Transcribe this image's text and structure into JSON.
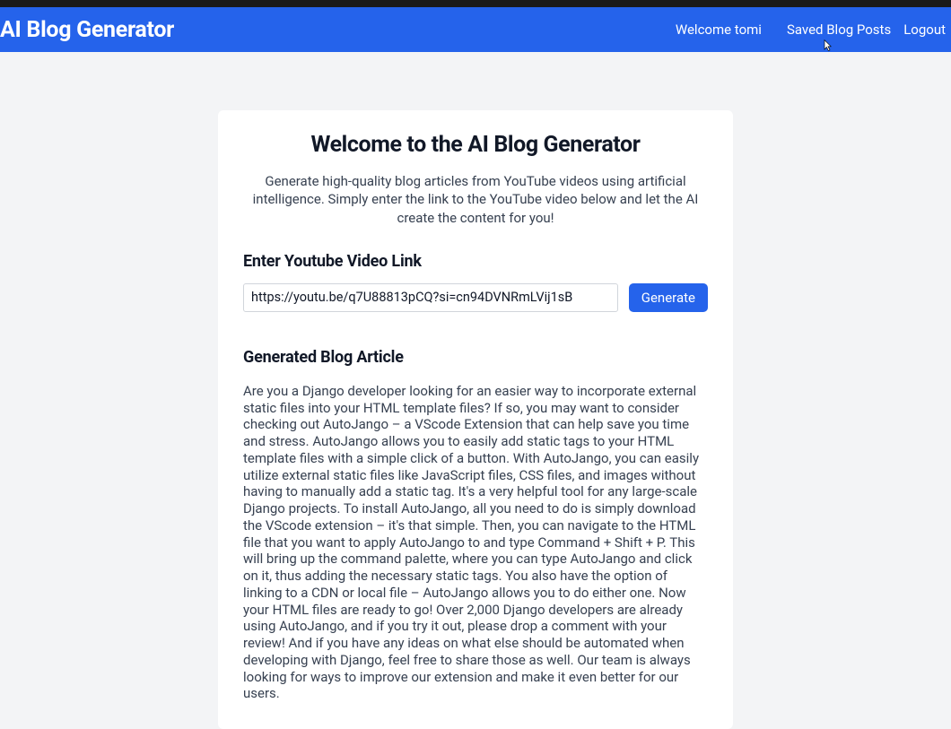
{
  "navbar": {
    "brand": "AI Blog Generator",
    "welcome": "Welcome tomi",
    "saved_link": "Saved Blog Posts",
    "logout_link": "Logout"
  },
  "main": {
    "title": "Welcome to the AI Blog Generator",
    "description": "Generate high-quality blog articles from YouTube videos using artificial intelligence. Simply enter the link to the YouTube video below and let the AI create the content for you!",
    "input_label": "Enter Youtube Video Link",
    "input_value": "https://youtu.be/q7U88813pCQ?si=cn94DVNRmLVij1sB",
    "generate_button": "Generate",
    "generated_label": "Generated Blog Article",
    "article": "Are you a Django developer looking for an easier way to incorporate external static files into your HTML template files? If so, you may want to consider checking out AutoJango – a VScode Extension that can help save you time and stress. AutoJango allows you to easily add static tags to your HTML template files with a simple click of a button. With AutoJango, you can easily utilize external static files like JavaScript files, CSS files, and images without having to manually add a static tag. It's a very helpful tool for any large-scale Django projects. To install AutoJango, all you need to do is simply download the VScode extension – it's that simple. Then, you can navigate to the HTML file that you want to apply AutoJango to and type Command + Shift + P. This will bring up the command palette, where you can type AutoJango and click on it, thus adding the necessary static tags. You also have the option of linking to a CDN or local file – AutoJango allows you to do either one. Now your HTML files are ready to go! Over 2,000 Django developers are already using AutoJango, and if you try it out, please drop a comment with your review! And if you have any ideas on what else should be automated when developing with Django, feel free to share those as well. Our team is always looking for ways to improve our extension and make it even better for our users."
  }
}
